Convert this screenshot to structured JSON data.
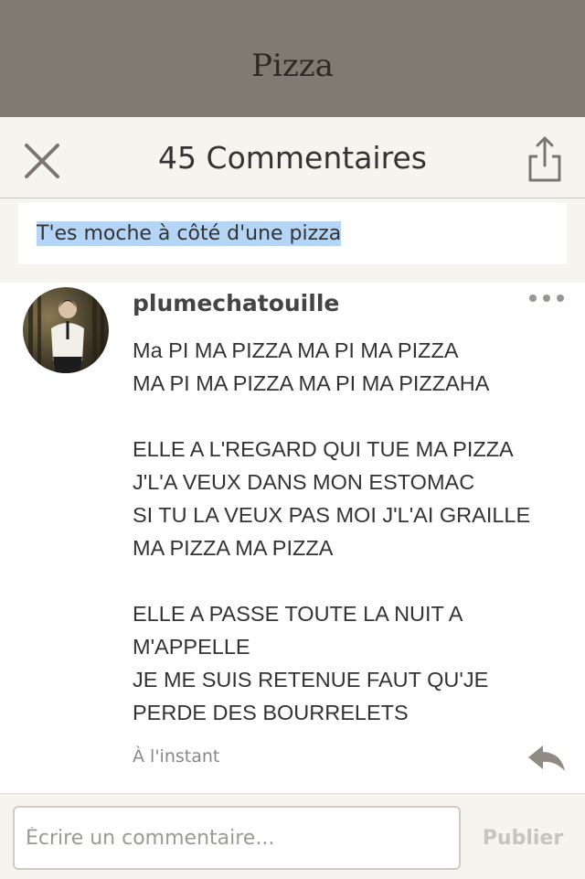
{
  "page": {
    "title": "Pizza"
  },
  "header": {
    "close_icon": "close-icon",
    "comment_count": "45 Commentaires",
    "share_icon": "share-icon"
  },
  "quote": {
    "text": "T'es moche à côté d'une pizza",
    "highlight_color": "#b5d5f6"
  },
  "comment": {
    "username": "plumechatouille",
    "more_icon": "more-dots-icon",
    "lines": [
      "Ma PI MA PIZZA MA PI MA PIZZA",
      "MA PI MA PIZZA MA PI MA PIZZAHA",
      "",
      "ELLE A L'REGARD QUI TUE MA PIZZA",
      "J'L'A VEUX DANS MON ESTOMAC",
      "SI TU LA VEUX PAS MOI J'L'AI GRAILLE",
      "MA PIZZA MA PIZZA",
      "",
      "ELLE A PASSE TOUTE LA NUIT A",
      "M'APPELLE",
      "JE ME SUIS RETENUE FAUT QU'JE",
      "PERDE DES BOURRELETS"
    ],
    "timestamp": "À l'instant",
    "reply_icon": "reply-icon"
  },
  "footer": {
    "placeholder": "Écrire un commentaire...",
    "publish_label": "Publier"
  },
  "colors": {
    "banner": "#7f7b70",
    "header_bg": "#f6f4ee",
    "icon": "#7a766d",
    "publish_disabled": "#c7c4be"
  }
}
